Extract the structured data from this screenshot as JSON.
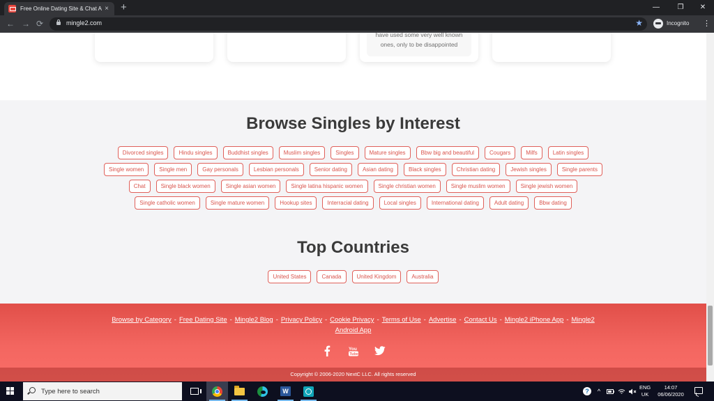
{
  "browser": {
    "tab_title": "Free Online Dating Site & Chat A",
    "tab_close": "×",
    "new_tab": "+",
    "url": "mingle2.com",
    "back": "←",
    "forward": "→",
    "reload": "⟳",
    "star": "★",
    "profile_label": "Incognito",
    "menu": "⋮",
    "minimize": "—",
    "maximize": "❐",
    "close": "✕"
  },
  "cards": [
    {
      "lines": [
        "..."
      ]
    },
    {
      "lines": [
        "..."
      ]
    },
    {
      "lines": [
        "have used some very well known",
        "ones, only to be disappointed"
      ]
    },
    {
      "lines": [
        "..."
      ]
    }
  ],
  "interest_section": {
    "title": "Browse Singles by Interest",
    "tags": [
      "Divorced singles",
      "Hindu singles",
      "Buddhist singles",
      "Muslim singles",
      "Singles",
      "Mature singles",
      "Bbw big and beautiful",
      "Cougars",
      "Milfs",
      "Latin singles",
      "Single women",
      "Single men",
      "Gay personals",
      "Lesbian personals",
      "Senior dating",
      "Asian dating",
      "Black singles",
      "Christian dating",
      "Jewish singles",
      "Single parents",
      "Chat",
      "Single black women",
      "Single asian women",
      "Single latina hispanic women",
      "Single christian women",
      "Single muslim women",
      "Single jewish women",
      "Single catholic women",
      "Single mature women",
      "Hookup sites",
      "Interracial dating",
      "Local singles",
      "International dating",
      "Adult dating",
      "Bbw dating"
    ]
  },
  "countries_section": {
    "title": "Top Countries",
    "tags": [
      "United States",
      "Canada",
      "United Kingdom",
      "Australia"
    ]
  },
  "footer": {
    "links": [
      "Browse by Category",
      "Free Dating Site",
      "Mingle2 Blog",
      "Privacy Policy",
      "Cookie Privacy",
      "Terms of Use",
      "Advertise",
      "Contact Us",
      "Mingle2 iPhone App",
      "Mingle2 Android App"
    ],
    "separator": "-",
    "social": [
      {
        "icon": "facebook-icon"
      },
      {
        "icon": "youtube-icon"
      },
      {
        "icon": "twitter-icon"
      }
    ],
    "copyright": "Copyright © 2006-2020 NextC LLC. All rights reserved"
  },
  "taskbar": {
    "search_placeholder": "Type here to search",
    "word_letter": "W",
    "help": "?",
    "tray_up": "^",
    "language_line1": "ENG",
    "language_line2": "UK",
    "time": "14:07",
    "date": "06/06/2020"
  },
  "colors": {
    "accent": "#e0605a",
    "footer_red": "#f36660",
    "heading": "#3a3a3a"
  }
}
